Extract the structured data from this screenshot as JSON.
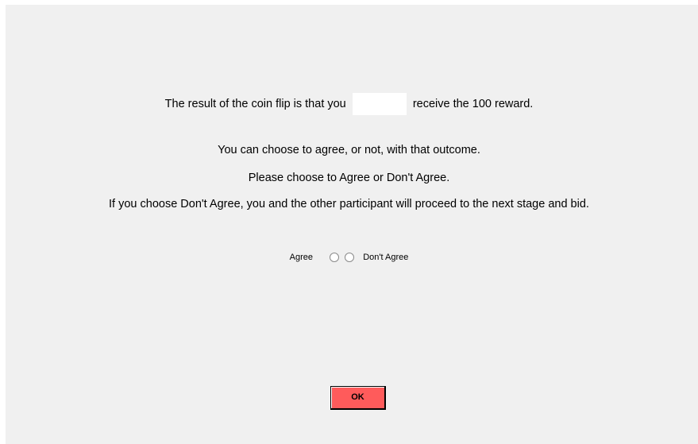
{
  "prompt": {
    "result_prefix": "The result of the coin flip is that you",
    "result_blank_value": "",
    "result_suffix": "receive the 100 reward.",
    "line_choose": "You can choose to agree, or not, with that outcome.",
    "line_please": "Please choose to Agree or Don't Agree.",
    "line_if": "If you choose Don't Agree, you and the other participant will proceed to the next stage and bid."
  },
  "choice": {
    "agree_label": "Agree",
    "disagree_label": "Don't Agree",
    "selected": null
  },
  "buttons": {
    "ok_label": "OK",
    "ok_color": "#ff5b5b"
  },
  "colors": {
    "background": "#f0f0f0"
  }
}
